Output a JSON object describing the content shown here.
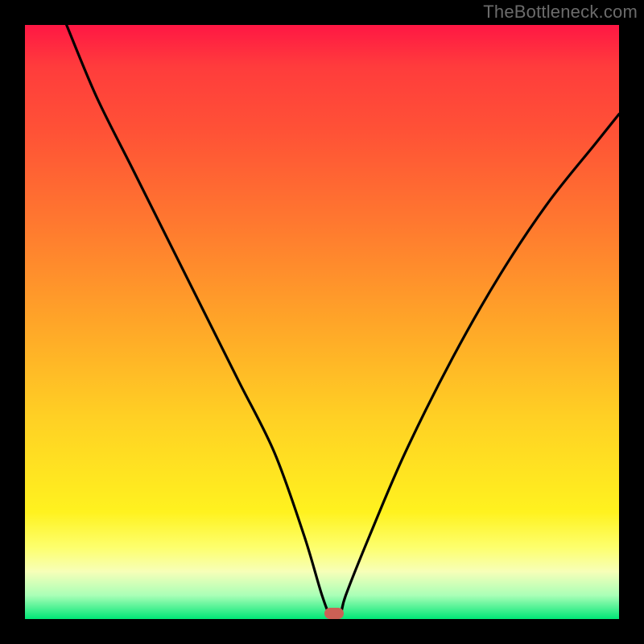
{
  "watermark": "TheBottleneck.com",
  "chart_data": {
    "type": "line",
    "title": "",
    "xlabel": "",
    "ylabel": "",
    "xlim": [
      0,
      100
    ],
    "ylim": [
      0,
      100
    ],
    "grid": false,
    "axes": "hidden",
    "background": "vertical rainbow gradient (red at top ~100% through orange/yellow to green at bottom ~0%)",
    "series": [
      {
        "name": "bottleneck-curve",
        "color": "#000000",
        "x": [
          7,
          12,
          18,
          24,
          30,
          36,
          42,
          47,
          50,
          51.5,
          53,
          54,
          58,
          64,
          72,
          80,
          88,
          96,
          100
        ],
        "y": [
          100,
          88,
          76,
          64,
          52,
          40,
          28,
          14,
          4,
          0.5,
          0.5,
          4,
          14,
          28,
          44,
          58,
          70,
          80,
          85
        ]
      }
    ],
    "marker": {
      "x": 52,
      "y": 1,
      "color": "#cc6055",
      "shape": "rounded-rect"
    }
  },
  "colors": {
    "frame": "#000000",
    "watermark": "#6b6b6b",
    "gradient_top": "#ff1744",
    "gradient_bottom": "#00e676",
    "curve": "#000000",
    "marker": "#cc6055"
  }
}
